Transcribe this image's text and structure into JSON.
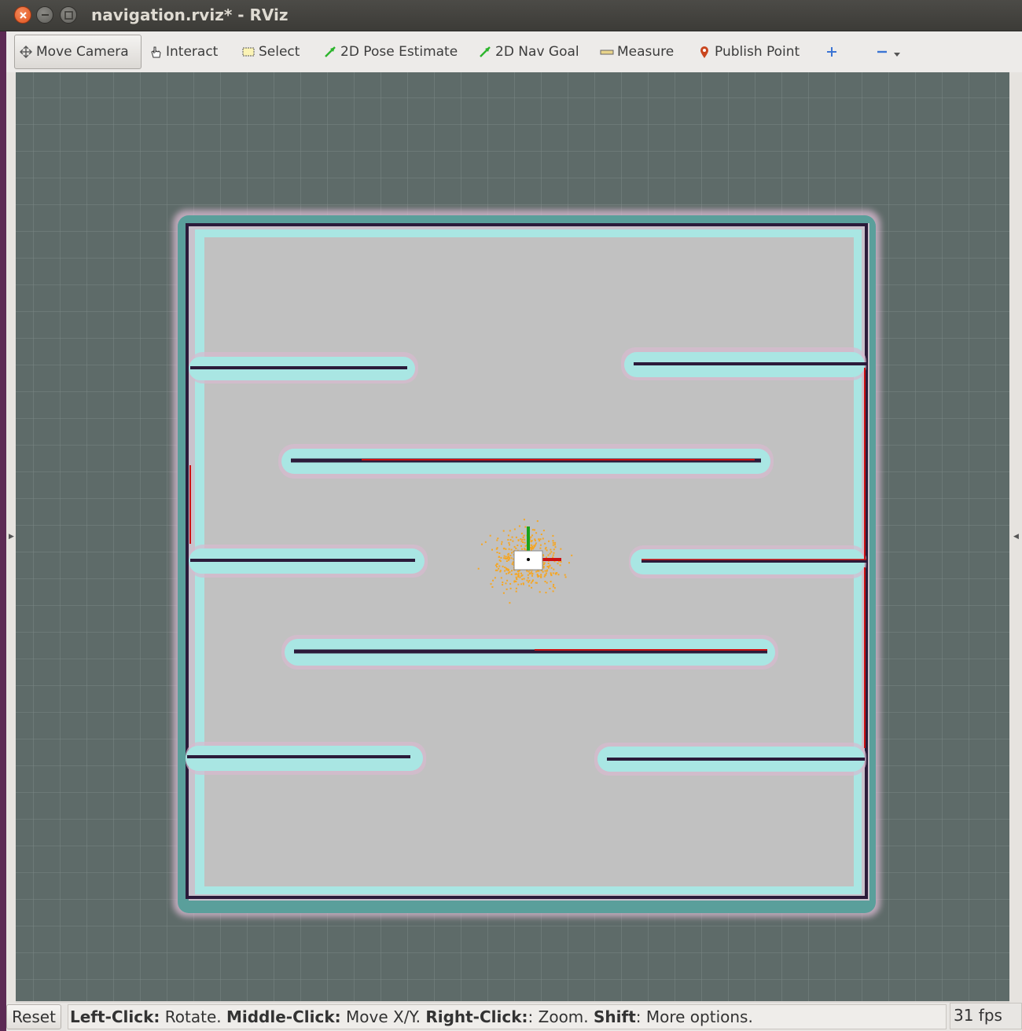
{
  "window": {
    "title": "navigation.rviz* - RViz"
  },
  "toolbar": {
    "tools": [
      {
        "label": "Move Camera",
        "icon": "move-camera-icon"
      },
      {
        "label": "Interact",
        "icon": "hand-icon"
      },
      {
        "label": "Select",
        "icon": "select-box-icon"
      },
      {
        "label": "2D Pose Estimate",
        "icon": "green-arrow-icon"
      },
      {
        "label": "2D Nav Goal",
        "icon": "green-arrow-icon"
      },
      {
        "label": "Measure",
        "icon": "ruler-icon"
      },
      {
        "label": "Publish Point",
        "icon": "map-pin-icon"
      }
    ],
    "add_tool_icon": "plus-icon",
    "remove_tool_icon": "minus-icon",
    "menu_icon": "chevron-down-icon"
  },
  "status": {
    "reset_label": "Reset",
    "hints": [
      {
        "key": "Left-Click:",
        "text": " Rotate. "
      },
      {
        "key": "Middle-Click:",
        "text": " Move X/Y. "
      },
      {
        "key": "Right-Click:",
        "text": ": Zoom. "
      },
      {
        "key": "Shift",
        "text": ": More options."
      }
    ],
    "fps": "31 fps"
  },
  "colors": {
    "background": "#5e6b69",
    "free_space": "#c1c1c1",
    "inflation_outer": "#5a9f9b",
    "inflation_inner": "#a9e6e3",
    "cost_pink": "#d7b9cf",
    "obstacle": "#2b1b3a",
    "laser_scan": "#cc1111",
    "particle_cloud": "#f5a623",
    "axis_x": "#cc1111",
    "axis_y": "#1aa31a"
  }
}
